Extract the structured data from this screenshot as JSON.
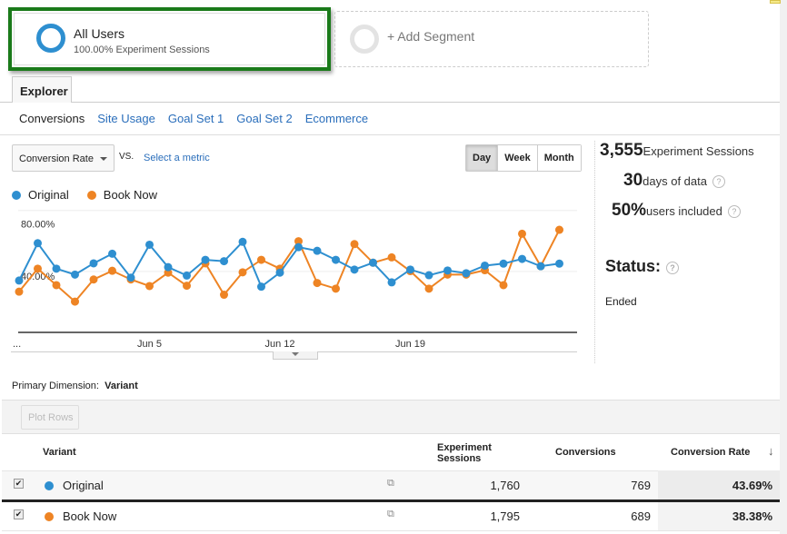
{
  "segments": {
    "active": {
      "title": "All Users",
      "subtitle": "100.00% Experiment Sessions"
    },
    "add_label": "+ Add Segment"
  },
  "tabs": {
    "explorer": "Explorer"
  },
  "subnav": [
    "Conversions",
    "Site Usage",
    "Goal Set 1",
    "Goal Set 2",
    "Ecommerce"
  ],
  "controls": {
    "metric": "Conversion Rate",
    "vs": "VS.",
    "select_metric": "Select a metric",
    "periods": [
      "Day",
      "Week",
      "Month"
    ],
    "selected_period": "Day"
  },
  "colors": {
    "original": "#2e8fd0",
    "book_now": "#ee8424",
    "highlight": "#1a7a1a"
  },
  "chart_data": {
    "type": "line",
    "x": [
      "May 29",
      "May 30",
      "May 31",
      "Jun 1",
      "Jun 2",
      "Jun 3",
      "Jun 4",
      "Jun 5",
      "Jun 6",
      "Jun 7",
      "Jun 8",
      "Jun 9",
      "Jun 10",
      "Jun 11",
      "Jun 12",
      "Jun 13",
      "Jun 14",
      "Jun 15",
      "Jun 16",
      "Jun 17",
      "Jun 18",
      "Jun 19",
      "Jun 20",
      "Jun 21",
      "Jun 22",
      "Jun 23",
      "Jun 24",
      "Jun 25",
      "Jun 26",
      "Jun 27"
    ],
    "x_tick_labels": [
      "...",
      "Jun 5",
      "Jun 12",
      "Jun 19"
    ],
    "y_tick_labels": [
      "80.00%",
      "40.00%"
    ],
    "ylim": [
      0,
      80
    ],
    "grid": true,
    "legend": "top-left",
    "series": [
      {
        "name": "Original",
        "values": [
          34,
          58.5,
          41.8,
          37.9,
          45.3,
          51.6,
          35.9,
          57.5,
          42.8,
          37.3,
          47.6,
          46.7,
          59.4,
          30,
          39.2,
          55.9,
          53.5,
          47.6,
          41.2,
          45.7,
          32.8,
          41.2,
          37.5,
          40.6,
          38.8,
          43.8,
          45.1,
          48.2,
          43.4,
          45.1
        ]
      },
      {
        "name": "Book Now",
        "values": [
          26.7,
          41.8,
          31,
          20.2,
          34.7,
          40.4,
          34.7,
          30.4,
          39.2,
          30.6,
          45.3,
          24.7,
          39.4,
          47.6,
          41.8,
          59.8,
          32.4,
          28.7,
          57.9,
          45.7,
          49.2,
          40.2,
          28.7,
          37.9,
          37.9,
          40.8,
          31,
          64.7,
          43.4,
          67.3
        ]
      }
    ]
  },
  "stats": {
    "sessions_value": "3,555",
    "sessions_label": "Experiment Sessions",
    "days_value": "30",
    "days_label": "days of data",
    "users_value": "50%",
    "users_label": "users included",
    "status_label": "Status:",
    "status_value": "Ended"
  },
  "table": {
    "primary_dimension_label": "Primary Dimension:",
    "primary_dimension_value": "Variant",
    "plot_rows": "Plot Rows",
    "headers": [
      "Variant",
      "Experiment Sessions",
      "Conversions",
      "Conversion Rate"
    ],
    "rows": [
      {
        "variant": "Original",
        "sessions": "1,760",
        "conversions": "769",
        "rate": "43.69%"
      },
      {
        "variant": "Book Now",
        "sessions": "1,795",
        "conversions": "689",
        "rate": "38.38%"
      }
    ]
  }
}
